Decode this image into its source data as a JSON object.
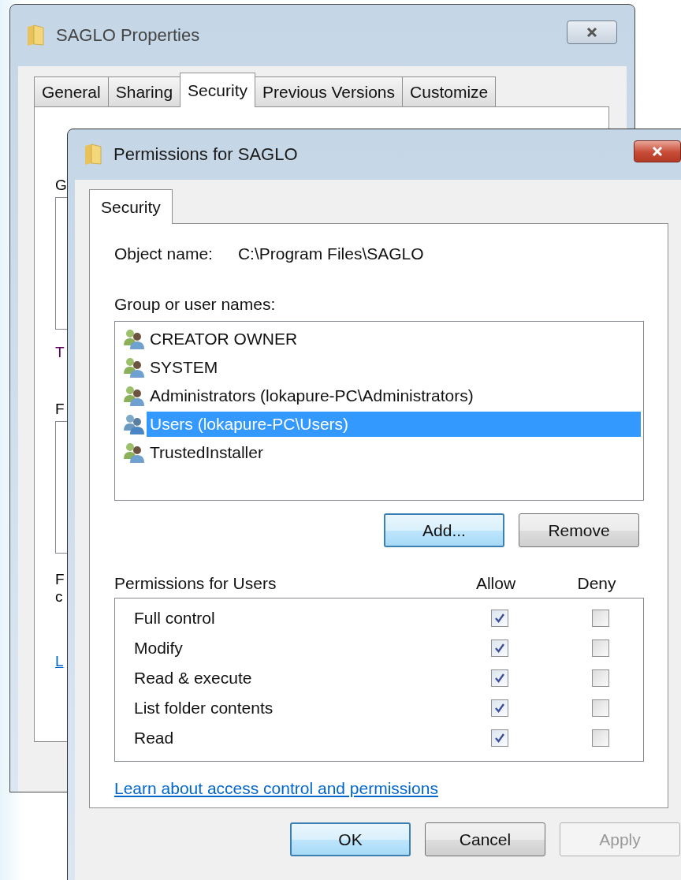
{
  "back_window": {
    "title": "SAGLO Properties",
    "tabs": [
      {
        "label": "General",
        "selected": false
      },
      {
        "label": "Sharing",
        "selected": false
      },
      {
        "label": "Security",
        "selected": true
      },
      {
        "label": "Previous Versions",
        "selected": false
      },
      {
        "label": "Customize",
        "selected": false
      }
    ],
    "fragments": [
      {
        "kind": "label",
        "text": "G"
      },
      {
        "kind": "list"
      },
      {
        "kind": "label",
        "text": "T"
      },
      {
        "kind": "label",
        "text": "F"
      },
      {
        "kind": "list"
      },
      {
        "kind": "label",
        "text": "F"
      },
      {
        "kind": "label",
        "text": "c"
      },
      {
        "kind": "link",
        "text": "L"
      }
    ]
  },
  "window": {
    "title": "Permissions for SAGLO",
    "tabs": [
      {
        "label": "Security",
        "selected": true
      }
    ],
    "object_name": {
      "label": "Object name:",
      "value": "C:\\Program Files\\SAGLO"
    },
    "group_label": "Group or user names:",
    "groups": [
      {
        "name": "CREATOR OWNER",
        "selected": false
      },
      {
        "name": "SYSTEM",
        "selected": false
      },
      {
        "name": "Administrators (lokapure-PC\\Administrators)",
        "selected": false
      },
      {
        "name": "Users (lokapure-PC\\Users)",
        "selected": true
      },
      {
        "name": "TrustedInstaller",
        "selected": false
      }
    ],
    "group_buttons": [
      {
        "label": "Add...",
        "highlighted": true,
        "disabled": false
      },
      {
        "label": "Remove",
        "highlighted": false,
        "disabled": false
      }
    ],
    "permissions_label": "Permissions for Users",
    "columns": [
      "Allow",
      "Deny"
    ],
    "permissions": [
      {
        "name": "Full control",
        "allow": true,
        "deny": false
      },
      {
        "name": "Modify",
        "allow": true,
        "deny": false
      },
      {
        "name": "Read & execute",
        "allow": true,
        "deny": false
      },
      {
        "name": "List folder contents",
        "allow": true,
        "deny": false
      },
      {
        "name": "Read",
        "allow": true,
        "deny": false
      }
    ],
    "link": "Learn about access control and permissions",
    "buttons": [
      {
        "label": "OK",
        "highlighted": true,
        "disabled": false
      },
      {
        "label": "Cancel",
        "highlighted": false,
        "disabled": false
      },
      {
        "label": "Apply",
        "highlighted": false,
        "disabled": true
      }
    ]
  }
}
